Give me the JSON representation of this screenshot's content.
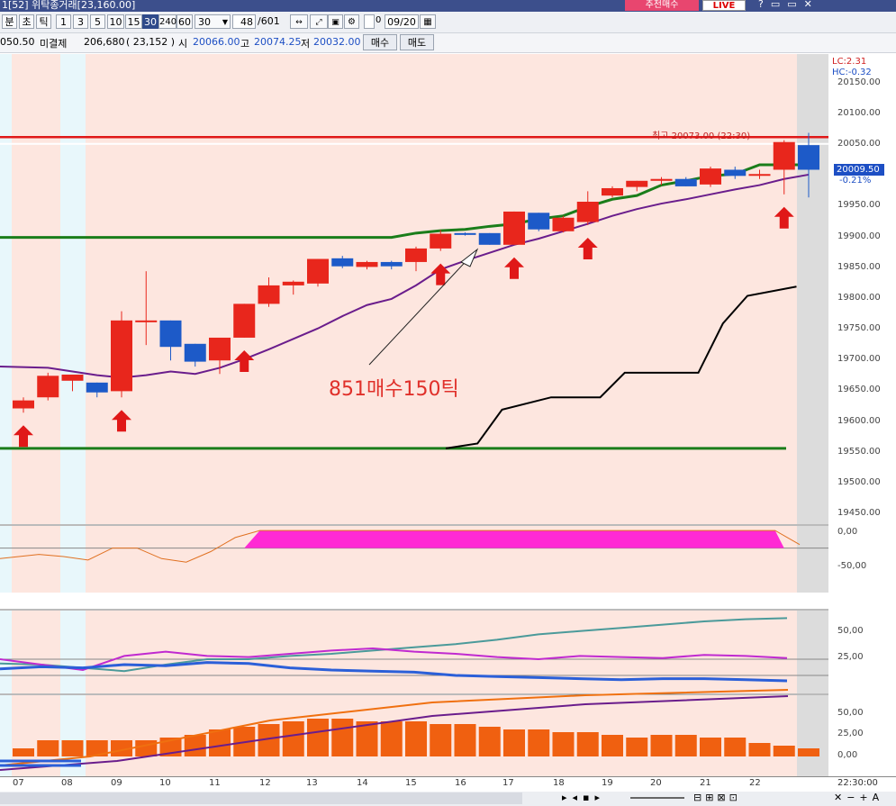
{
  "titlebar": {
    "title": "1[52] 위탁종거래[23,160.00]",
    "rec_button": "추천매수",
    "live_button": "LIVE",
    "icons": "?▭▭✕"
  },
  "toolbar": {
    "items": [
      {
        "label": "분",
        "active": true
      },
      {
        "label": "초",
        "active": false
      },
      {
        "label": "틱",
        "active": false
      },
      {
        "label": "1",
        "active": false
      },
      {
        "label": "3",
        "active": false
      },
      {
        "label": "5",
        "active": false
      },
      {
        "label": "10",
        "active": false
      },
      {
        "label": "15",
        "active": false
      },
      {
        "label": "30",
        "active": true
      },
      {
        "label": "240",
        "active": false
      },
      {
        "label": "60",
        "active": false
      }
    ],
    "period_select": "30",
    "count_value": "48",
    "count_total": "/601",
    "date_value": "09/20"
  },
  "quote": {
    "last": "050.50",
    "label_oi": "미결제",
    "oi_value": "206,680",
    "oi_paren": "( 23,152 )",
    "label_open": "시",
    "open": "20066.00",
    "label_high": "고",
    "high": "20074.25",
    "label_low": "저",
    "low": "20032.00",
    "buy_button": "매수",
    "sell_button": "매도"
  },
  "overlay": {
    "annotation": "851매수150틱",
    "high_marker": "최고 20073.00 (22:30)",
    "lc": "LC:2.31",
    "hc": "HC:-0.32",
    "last_price": "20009.50",
    "last_change": "-0.21%"
  },
  "colors": {
    "up": "#e8261c",
    "down": "#1d5ac8",
    "bg_chart": "#fde6df",
    "bg_cyan": "#e8f7fb",
    "green": "#1a7d1a",
    "purple": "#6a1d8c",
    "magenta": "#ff2ad4"
  },
  "chart_data": {
    "type": "candlestick",
    "y_ticks": [
      "20150.00",
      "20100.00",
      "20050.00",
      "19950.00",
      "19900.00",
      "19850.00",
      "19800.00",
      "19750.00",
      "19700.00",
      "19650.00",
      "19600.00",
      "19550.00",
      "19500.00",
      "19450.00"
    ],
    "x_ticks": [
      "07",
      "08",
      "09",
      "10",
      "11",
      "12",
      "13",
      "14",
      "15",
      "16",
      "17",
      "18",
      "19",
      "20",
      "21",
      "22",
      "22:30:00"
    ],
    "horizontal_lines": [
      20063,
      19900,
      19557
    ],
    "candles": [
      {
        "o": 19622,
        "h": 19640,
        "l": 19615,
        "c": 19635
      },
      {
        "o": 19640,
        "h": 19680,
        "l": 19635,
        "c": 19675
      },
      {
        "o": 19667,
        "h": 19677,
        "l": 19650,
        "c": 19677
      },
      {
        "o": 19664,
        "h": 19664,
        "l": 19640,
        "c": 19648
      },
      {
        "o": 19650,
        "h": 19780,
        "l": 19640,
        "c": 19765
      },
      {
        "o": 19765,
        "h": 19845,
        "l": 19725,
        "c": 19765
      },
      {
        "o": 19765,
        "h": 19765,
        "l": 19700,
        "c": 19722
      },
      {
        "o": 19727,
        "h": 19727,
        "l": 19690,
        "c": 19698
      },
      {
        "o": 19700,
        "h": 19737,
        "l": 19678,
        "c": 19737
      },
      {
        "o": 19737,
        "h": 19792,
        "l": 19737,
        "c": 19792
      },
      {
        "o": 19792,
        "h": 19835,
        "l": 19787,
        "c": 19822
      },
      {
        "o": 19822,
        "h": 19830,
        "l": 19807,
        "c": 19828
      },
      {
        "o": 19825,
        "h": 19865,
        "l": 19820,
        "c": 19865
      },
      {
        "o": 19866,
        "h": 19870,
        "l": 19850,
        "c": 19853
      },
      {
        "o": 19852,
        "h": 19862,
        "l": 19848,
        "c": 19860
      },
      {
        "o": 19860,
        "h": 19862,
        "l": 19848,
        "c": 19853
      },
      {
        "o": 19860,
        "h": 19885,
        "l": 19845,
        "c": 19882
      },
      {
        "o": 19882,
        "h": 19912,
        "l": 19878,
        "c": 19906
      },
      {
        "o": 19907,
        "h": 19908,
        "l": 19903,
        "c": 19905
      },
      {
        "o": 19907,
        "h": 19907,
        "l": 19888,
        "c": 19888
      },
      {
        "o": 19888,
        "h": 19942,
        "l": 19888,
        "c": 19942
      },
      {
        "o": 19940,
        "h": 19940,
        "l": 19910,
        "c": 19913
      },
      {
        "o": 19910,
        "h": 19935,
        "l": 19908,
        "c": 19932
      },
      {
        "o": 19925,
        "h": 19975,
        "l": 19920,
        "c": 19958
      },
      {
        "o": 19968,
        "h": 19983,
        "l": 19965,
        "c": 19980
      },
      {
        "o": 19982,
        "h": 19992,
        "l": 19975,
        "c": 19992
      },
      {
        "o": 19992,
        "h": 19998,
        "l": 19985,
        "c": 19995
      },
      {
        "o": 19995,
        "h": 19998,
        "l": 19983,
        "c": 19983
      },
      {
        "o": 19986,
        "h": 20015,
        "l": 19982,
        "c": 20012
      },
      {
        "o": 20010,
        "h": 20015,
        "l": 19995,
        "c": 20000
      },
      {
        "o": 20003,
        "h": 20010,
        "l": 19995,
        "c": 20003
      },
      {
        "o": 20010,
        "h": 20058,
        "l": 19970,
        "c": 20055
      },
      {
        "o": 20050,
        "h": 20070,
        "l": 19965,
        "c": 20010
      }
    ],
    "trail_line": [
      [
        19557,
        0
      ],
      [
        19565,
        19
      ],
      [
        19620,
        20
      ],
      [
        19640,
        22
      ],
      [
        19640,
        24
      ],
      [
        19680,
        25
      ],
      [
        19680,
        28
      ],
      [
        19760,
        29
      ],
      [
        19805,
        30
      ],
      [
        19820,
        32
      ]
    ],
    "ma_purple": [
      19690,
      19688,
      19682,
      19676,
      19672,
      19676,
      19682,
      19678,
      19688,
      19702,
      19718,
      19735,
      19752,
      19772,
      19790,
      19800,
      19822,
      19848,
      19862,
      19875,
      19888,
      19898,
      19910,
      19922,
      19935,
      19946,
      19955,
      19962,
      19970,
      19978,
      19985,
      19995,
      20002
    ],
    "ma_green": [
      19900,
      19907,
      19911,
      19913,
      19918,
      19922,
      19930,
      19935,
      19950,
      19962,
      19968,
      19985,
      19992,
      20000,
      20003,
      20018,
      20018,
      20018
    ],
    "up_arrows": [
      0,
      4,
      9,
      17,
      20,
      23,
      31
    ],
    "osc1": [
      -35,
      -29,
      -32,
      -37,
      -20,
      -20,
      -35,
      -40,
      -25,
      -5,
      5,
      5,
      5,
      5,
      5,
      5,
      5,
      5,
      5,
      5,
      5,
      5,
      5,
      5,
      5,
      5,
      5,
      5,
      5,
      5,
      5,
      5,
      -15
    ],
    "dmi_teal": [
      21,
      20,
      17,
      14,
      20,
      25,
      25,
      28,
      30,
      33,
      36,
      39,
      43,
      48,
      51,
      54,
      57,
      60,
      62,
      63
    ],
    "dmi_magenta": [
      25,
      20,
      15,
      28,
      32,
      28,
      27,
      30,
      33,
      35,
      32,
      30,
      27,
      25,
      28,
      27,
      26,
      29,
      28,
      26
    ],
    "dmi_blue": [
      16,
      18,
      17,
      20,
      19,
      22,
      21,
      17,
      15,
      14,
      13,
      10,
      9,
      8,
      7,
      6,
      7,
      7,
      6,
      5
    ],
    "vol_bars": [
      3,
      6,
      6,
      6,
      6,
      6,
      7,
      8,
      10,
      11,
      12,
      13,
      14,
      14,
      13,
      13,
      13,
      12,
      12,
      11,
      10,
      10,
      9,
      9,
      8,
      7,
      8,
      8,
      7,
      7,
      5,
      4,
      3
    ]
  }
}
